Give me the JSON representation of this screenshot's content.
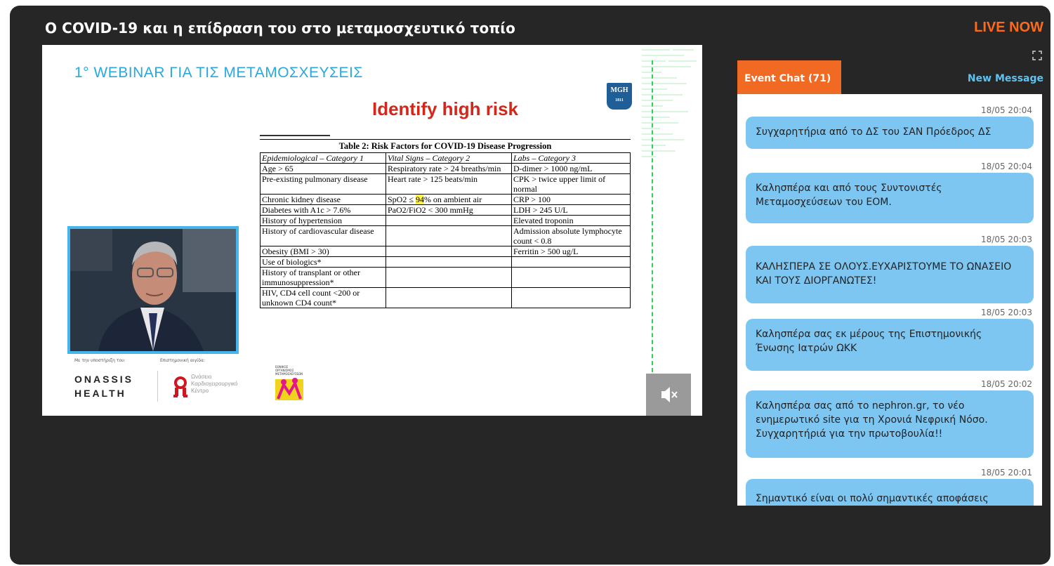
{
  "header": {
    "title": "Ο COVID-19 και η επίδραση του στο μεταμοσχευτικό τοπίο",
    "live_label": "LIVE NOW",
    "fullscreen_icon": "fullscreen-icon"
  },
  "video": {
    "webinar_title": "1° WEBINAR ΓΙΑ ΤΙΣ ΜΕΤΑΜΟΣΧΕΥΣΕΙΣ",
    "slide": {
      "heading": "Identify high risk",
      "logo_text_top": "MGH",
      "logo_text_bottom": "1811",
      "table_caption": "Table 2: Risk Factors for COVID-19 Disease Progression",
      "columns": [
        "Epidemiological – Category 1",
        "Vital Signs – Category 2",
        "Labs – Category 3"
      ],
      "rows": [
        [
          "Age > 65",
          "Respiratory rate > 24 breaths/min",
          "D-dimer > 1000 ng/mL"
        ],
        [
          "Pre-existing pulmonary disease",
          "Heart rate > 125 beats/min",
          "CPK > twice upper limit of normal"
        ],
        [
          "Chronic kidney disease",
          "SpO2 ≤ 94% on ambient air",
          "CRP > 100"
        ],
        [
          "Diabetes with A1c > 7.6%",
          "PaO2/FiO2 < 300 mmHg",
          "LDH > 245 U/L"
        ],
        [
          "History of hypertension",
          "",
          "Elevated troponin"
        ],
        [
          "History of cardiovascular disease",
          "",
          "Admission absolute lymphocyte count < 0.8"
        ],
        [
          "Obesity (BMI > 30)",
          "",
          "Ferritin > 500 ug/L"
        ],
        [
          "Use of biologics*",
          "",
          ""
        ],
        [
          "History of transplant or other immunosuppression*",
          "",
          ""
        ],
        [
          "HIV, CD4 cell count <200 or unknown CD4 count*",
          "",
          ""
        ]
      ]
    },
    "sponsor_label": "Με την υποστήριξη του:",
    "scientific_label": "Επιστημονική αιγίδα:",
    "onassis_line1": "ONASSIS",
    "onassis_line2": "HEALTH",
    "ok_text_1": "Ωνάσειο",
    "ok_text_2": "Καρδιοχειρουργικό",
    "ok_text_3": "Κέντρο",
    "eom_text": "ΕΘΝΙΚΟΣ ΟΡΓΑΝΙΣΜΟΣ ΜΕΤΑΜΟΣΧΕΥΣΕΩΝ",
    "mute_icon": "mute-icon"
  },
  "chat": {
    "tab_label": "Event Chat (71)",
    "new_message_label": "New Message",
    "messages": [
      {
        "time": "18/05 20:04",
        "text": "Συγχαρητήρια από το ΔΣ του ΣΑΝ Πρόεδρος ΔΣ"
      },
      {
        "time": "18/05 20:04",
        "text": "Καλησπέρα και από τους Συντονιστές Μεταμοσχεύσεων του ΕΟΜ."
      },
      {
        "time": "18/05 20:03",
        "text": "ΚΑΛΗΣΠΕΡΑ ΣΕ ΟΛΟΥΣ.ΕΥΧΑΡΙΣΤΟΥΜΕ ΤΟ ΩΝΑΣΕΙΟ ΚΑΙ ΤΟΥΣ ΔΙΟΡΓΑΝΩΤΕΣ!"
      },
      {
        "time": "18/05 20:03",
        "text": "Καλησπέρα σας εκ μέρους της Επιστημονικής Ένωσης Ιατρών ΩΚΚ"
      },
      {
        "time": "18/05 20:02",
        "text": "Καλησπέρα σας από το nephron.gr, το νέο ενημερωτικό site για τη Χρονιά Νεφρική Νόσο. Συγχαρητήριά για την πρωτοβουλία!!"
      },
      {
        "time": "18/05 20:01",
        "text": "Σημαντικό είναι οι πολύ σημαντικές αποφάσεις"
      }
    ]
  }
}
